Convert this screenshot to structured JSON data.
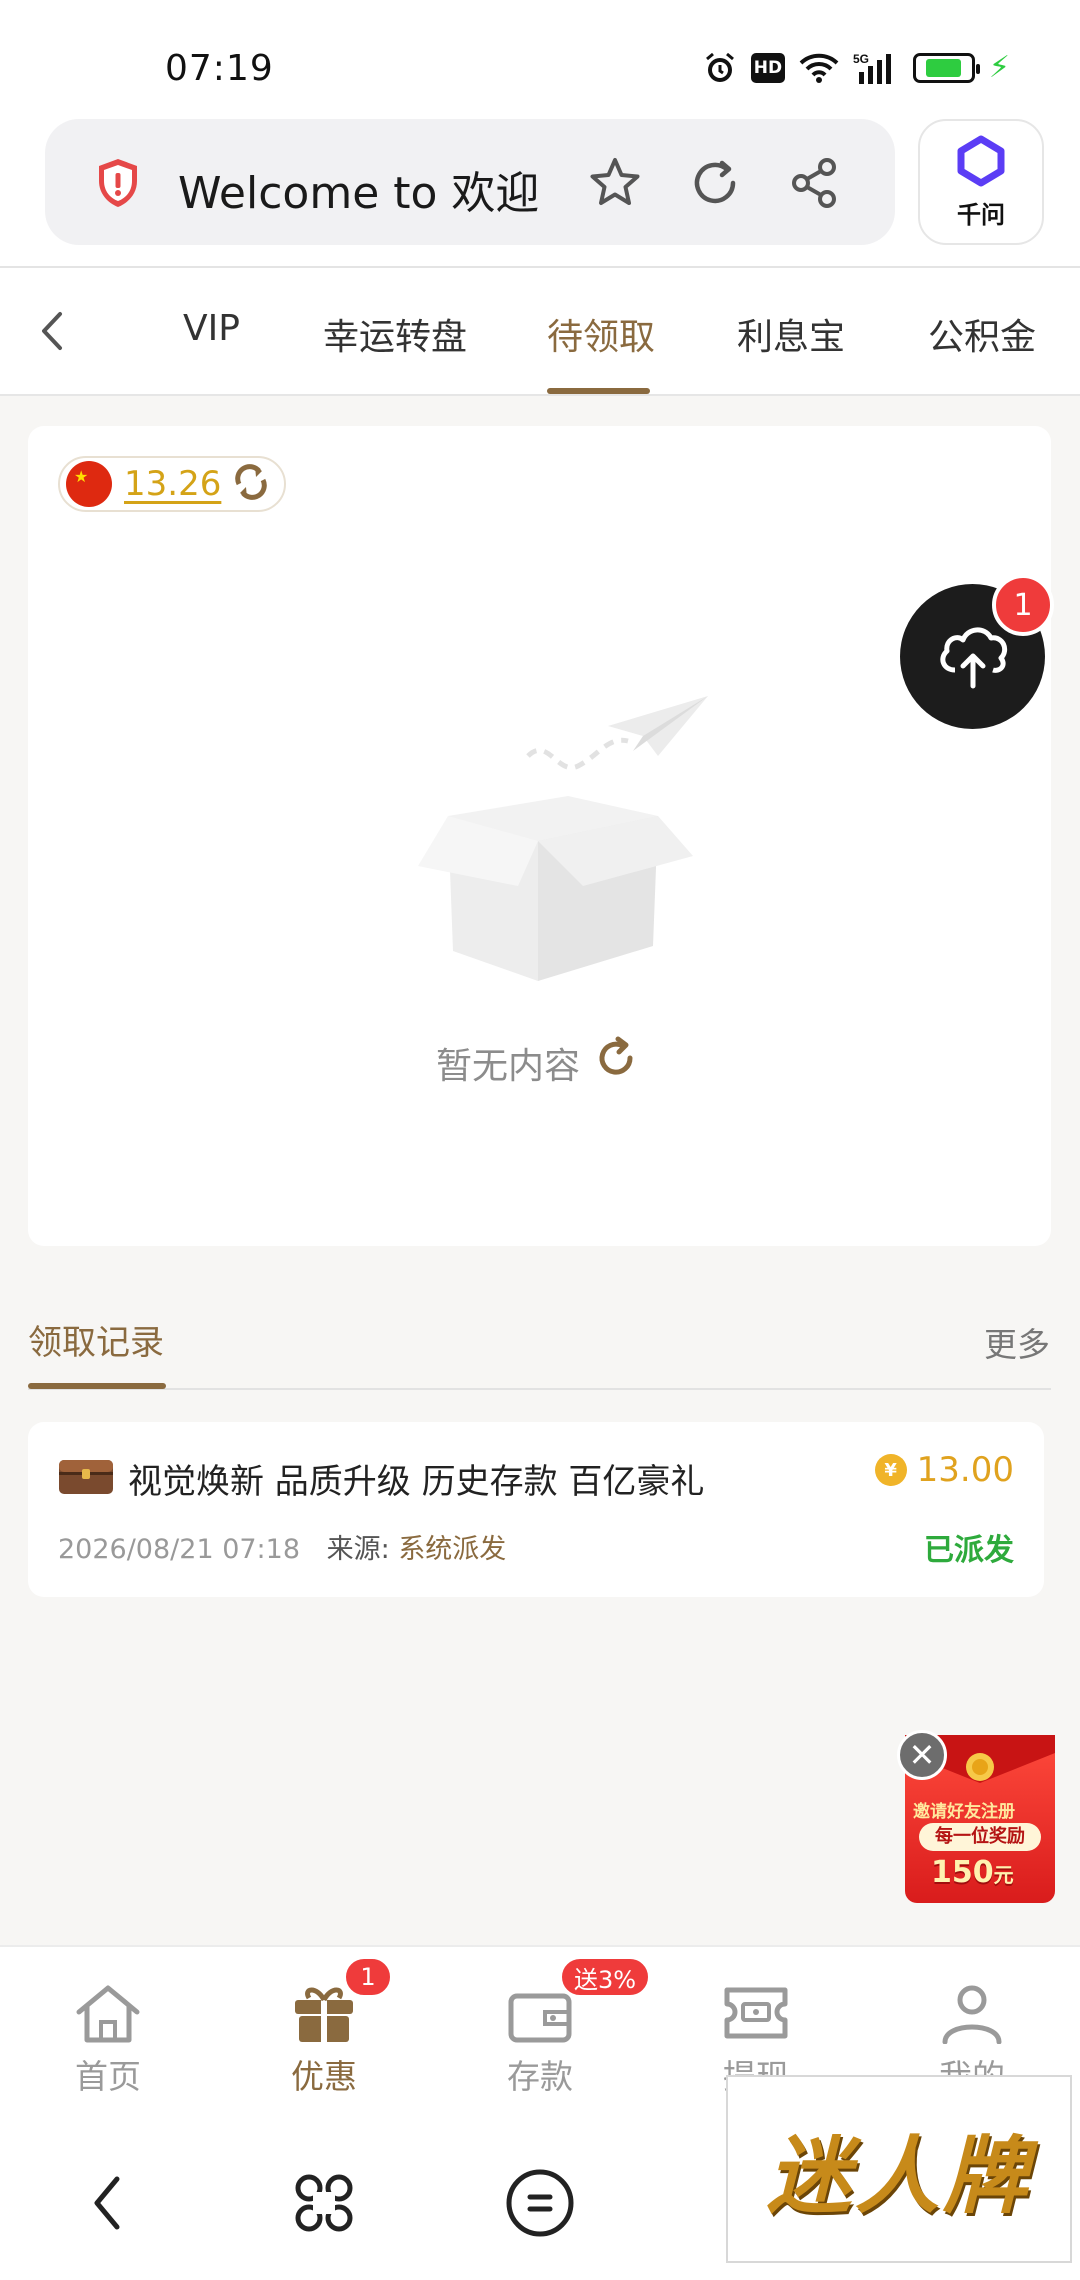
{
  "status_bar": {
    "time": "07:19",
    "hd": "HD",
    "network": "5G"
  },
  "browser": {
    "url_title": "Welcome to 欢迎",
    "assistant_label": "千问"
  },
  "tabs": [
    {
      "label": "VIP"
    },
    {
      "label": "幸运转盘"
    },
    {
      "label": "待领取",
      "active": true
    },
    {
      "label": "利息宝"
    },
    {
      "label": "公积金"
    }
  ],
  "balance": {
    "value": "13.26"
  },
  "empty_state": {
    "text": "暂无内容"
  },
  "floating_button": {
    "badge": "1"
  },
  "records": {
    "title": "领取记录",
    "more": "更多",
    "items": [
      {
        "title": "视觉焕新 品质升级 历史存款 百亿豪礼",
        "amount": "13.00",
        "coin_symbol": "¥",
        "datetime": "2026/08/21 07:18",
        "source_label": "来源:",
        "source_value": "系统派发",
        "status": "已派发"
      }
    ]
  },
  "promo": {
    "line1": "邀请好友注册",
    "line2": "每一位奖励",
    "amount": "150",
    "unit": "元",
    "close": "✕"
  },
  "bottom_nav": [
    {
      "label": "首页",
      "icon": "home-icon"
    },
    {
      "label": "优惠",
      "icon": "gift-icon",
      "badge": "1",
      "active": true
    },
    {
      "label": "存款",
      "icon": "wallet-icon",
      "badge": "送3%"
    },
    {
      "label": "提现",
      "icon": "withdraw-icon"
    },
    {
      "label": "我的",
      "icon": "profile-icon"
    }
  ],
  "watermark": {
    "text": "迷人牌"
  },
  "colors": {
    "accent": "#8a6a3f",
    "gold": "#e0a21e",
    "success": "#2eaa3c",
    "badge": "#ef3b3b"
  }
}
